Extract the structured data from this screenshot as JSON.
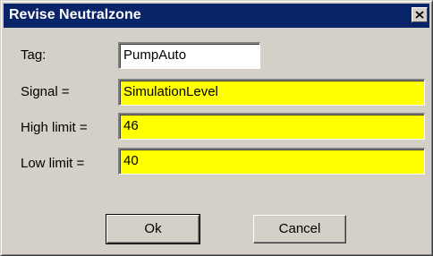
{
  "window": {
    "title": "Revise Neutralzone",
    "close_icon": "close-icon"
  },
  "form": {
    "tag_label": "Tag:",
    "tag_value": "PumpAuto",
    "signal_label": "Signal =",
    "signal_value": "SimulationLevel",
    "high_label": "High limit =",
    "high_value": "46",
    "low_label": "Low limit =",
    "low_value": "40"
  },
  "buttons": {
    "ok_label": "Ok",
    "cancel_label": "Cancel"
  },
  "colors": {
    "titlebar": "#0a246a",
    "highlight_field": "#ffff00",
    "dialog_face": "#d4d0c8"
  }
}
